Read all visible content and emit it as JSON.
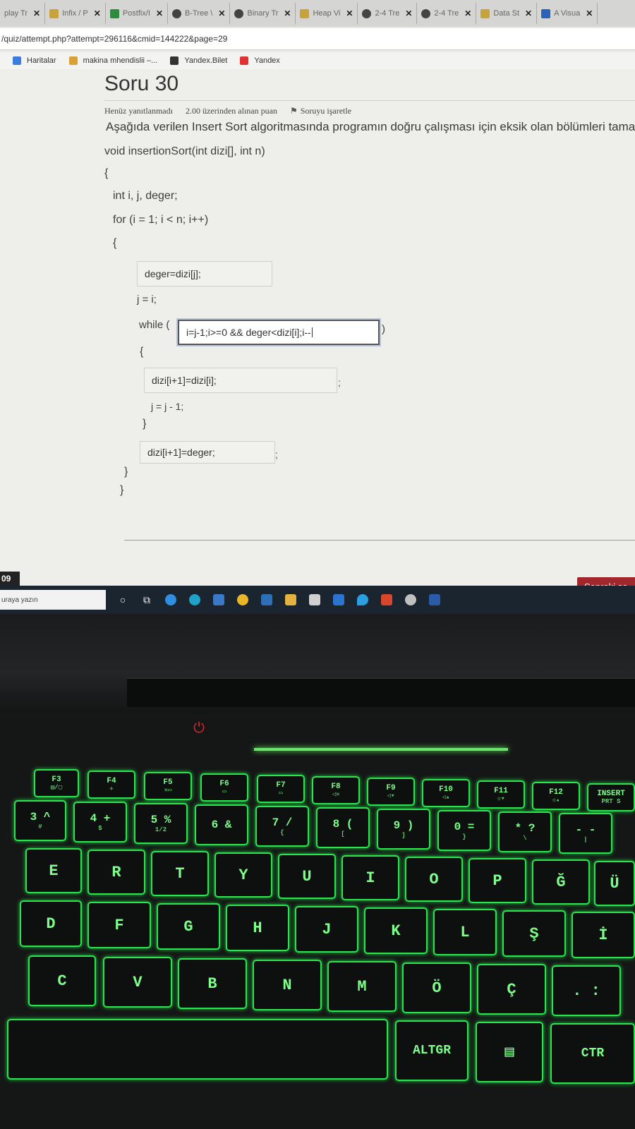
{
  "browser": {
    "tabs": [
      {
        "title": "play Tr",
        "icon": "tab-favicon-icon"
      },
      {
        "title": "Infix / P",
        "icon": "tab-favicon-icon"
      },
      {
        "title": "Postfix/I",
        "icon": "tab-favicon-icon"
      },
      {
        "title": "B-Tree \\",
        "icon": "tab-favicon-icon"
      },
      {
        "title": "Binary Tr",
        "icon": "tab-favicon-icon"
      },
      {
        "title": "Heap Vi",
        "icon": "tab-favicon-icon"
      },
      {
        "title": "2-4 Tre",
        "icon": "tab-favicon-icon"
      },
      {
        "title": "2-4 Tre",
        "icon": "tab-favicon-icon"
      },
      {
        "title": "Data St",
        "icon": "tab-favicon-icon"
      },
      {
        "title": "A Visua",
        "icon": "tab-favicon-icon"
      }
    ],
    "close_glyph": "✕",
    "url": "/quiz/attempt.php?attempt=296116&cmid=144222&page=29",
    "bookmarks": [
      "Haritalar",
      "makina mhendislii –...",
      "Yandex.Bilet",
      "Yandex"
    ]
  },
  "question": {
    "title": "Soru 30",
    "status": "Henüz yanıtlanmadı",
    "points": "2.00 üzerinden alınan puan",
    "flag_label": "Soruyu işaretle",
    "text": "Aşağıda verilen Insert Sort algoritmasında programın doğru çalışması için eksik olan bölümleri tamam",
    "code": {
      "signature": "void insertionSort(int dizi[], int n)",
      "open_brace": "{",
      "decl": "int i, j, deger;",
      "for_line": "for (i = 1; i < n; i++)",
      "for_open": "{",
      "blank1": "deger=dizi[j];",
      "j_assign": "j = i;",
      "while_prefix": "while (",
      "blank2": "i=j-1;i>=0 && deger<dizi[i];i--",
      "while_suffix": ")",
      "while_open": "{",
      "blank3": "dizi[i+1]=dizi[i];",
      "semi3": ";",
      "j_dec": "j = j - 1;",
      "while_close": "}",
      "blank4": "dizi[i+1]=deger;",
      "semi4": ";",
      "for_close": "}",
      "fn_close": "}"
    }
  },
  "footer": {
    "timer": "09",
    "next_button": "Sonraki sa"
  },
  "taskbar": {
    "search_placeholder": "uraya yazın"
  },
  "keyboard": {
    "fn_row": [
      {
        "label": "F3",
        "sub": "▤/▢"
      },
      {
        "label": "F4",
        "sub": "✈"
      },
      {
        "label": "F5",
        "sub": "✕▭"
      },
      {
        "label": "F6",
        "sub": "▭"
      },
      {
        "label": "F7",
        "sub": "▭"
      },
      {
        "label": "F8",
        "sub": "◁✕"
      },
      {
        "label": "F9",
        "sub": "◁▾"
      },
      {
        "label": "F10",
        "sub": "◁▴"
      },
      {
        "label": "F11",
        "sub": "☼▾"
      },
      {
        "label": "F12",
        "sub": "☼▴"
      },
      {
        "label": "INSERT",
        "sub": "PRT S"
      }
    ],
    "num_row": [
      "3 ^",
      "4 +",
      "5 %",
      "6 &",
      "7 /",
      "8 (",
      "9 )",
      "0 =",
      "* ?",
      "- -"
    ],
    "num_row_sub": [
      "#",
      "$",
      "1/2",
      "",
      "{",
      "[",
      "]",
      "}",
      "\\",
      "|"
    ],
    "row_q": [
      "E",
      "R",
      "T",
      "Y",
      "U",
      "I",
      "O",
      "P",
      "Ğ",
      "Ü"
    ],
    "row_a": [
      "D",
      "F",
      "G",
      "H",
      "J",
      "K",
      "L",
      "Ş",
      "İ"
    ],
    "row_z": [
      "C",
      "V",
      "B",
      "N",
      "M",
      "Ö",
      "Ç",
      ". :"
    ],
    "bottom": {
      "altgr": "ALTGR",
      "menu": "▤",
      "ctrl": "CTR"
    }
  },
  "colors": {
    "accent": "#a1272d",
    "keyboard_glow": "#27e54d",
    "power": "#e02424"
  }
}
